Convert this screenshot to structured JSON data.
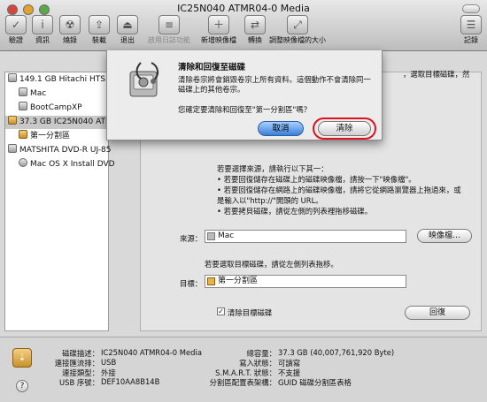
{
  "window": {
    "title": "IC25N040 ATMR04-0 Media"
  },
  "toolbar": {
    "items": [
      {
        "label": "驗證",
        "icon": "verify-icon"
      },
      {
        "label": "資訊",
        "icon": "info-icon"
      },
      {
        "label": "燒錄",
        "icon": "burn-icon"
      },
      {
        "label": "裝載",
        "icon": "mount-icon"
      },
      {
        "label": "退出",
        "icon": "eject-icon"
      },
      {
        "label": "啟用日誌功能",
        "icon": "journal-icon"
      },
      {
        "label": "新增映像檔",
        "icon": "new-image-icon"
      },
      {
        "label": "轉換",
        "icon": "convert-icon"
      },
      {
        "label": "調整映像檔的大小",
        "icon": "resize-image-icon"
      },
      {
        "label": "記錄",
        "icon": "log-icon"
      }
    ]
  },
  "sidebar": {
    "items": [
      {
        "label": "149.1 GB Hitachi HTS5"
      },
      {
        "label": "Mac"
      },
      {
        "label": "BootCampXP"
      },
      {
        "label": "37.3 GB IC25N040 ATM"
      },
      {
        "label": "第一分割區"
      },
      {
        "label": "MATSHITA DVD-R UJ-85"
      },
      {
        "label": "Mac OS X Install DVD"
      }
    ]
  },
  "restore": {
    "hint_right": "，選取目標磁碟，然",
    "source_instructions": [
      "若要選擇來源，請執行以下其一：",
      "• 若要回復儲存在磁碟上的磁碟映像檔，請按一下\"映像檔\"。",
      "• 若要回復儲存在網路上的磁碟映像檔，請將它從網路瀏覽器上拖過來，或",
      "   是輸入以\"http://\"開頭的 URL。",
      "• 若要拷貝磁碟，請從左側的列表裡拖移磁碟。"
    ],
    "source_label": "來源：",
    "source_value": "Mac",
    "image_button": "映像檔…",
    "target_instruction": "若要選取目標磁碟，請從左側列表拖移。",
    "target_label": "目標：",
    "target_value": "第一分割區",
    "erase_checkbox": "清除目標磁碟",
    "restore_button": "回復"
  },
  "info": {
    "left": [
      {
        "k": "磁碟描述：",
        "v": "IC25N040 ATMR04-0 Media"
      },
      {
        "k": "連接匯流排：",
        "v": "USB"
      },
      {
        "k": "連接類型：",
        "v": "外接"
      },
      {
        "k": "USB 序號：",
        "v": "DEF10AA8B14B"
      }
    ],
    "right": [
      {
        "k": "總容量：",
        "v": "37.3 GB (40,007,761,920 Byte)"
      },
      {
        "k": "寫入狀態：",
        "v": "可讀寫"
      },
      {
        "k": "S.M.A.R.T. 狀態：",
        "v": "不支援"
      },
      {
        "k": "分割區配置表架構：",
        "v": "GUID 磁碟分割區表格"
      }
    ],
    "help": "?"
  },
  "dialog": {
    "title": "清除和回復至磁碟",
    "message_lines": [
      "清除卷宗將會銷毀卷宗上所有資料。這個動作不會清除同一",
      "磁碟上的其他卷宗。"
    ],
    "question": "您確定要清除和回復至\"第一分割區\"嗎？",
    "cancel": "取消",
    "erase": "清除"
  },
  "colors": {
    "accent": "#3b7fd8",
    "highlight_ring": "#e0101e"
  }
}
